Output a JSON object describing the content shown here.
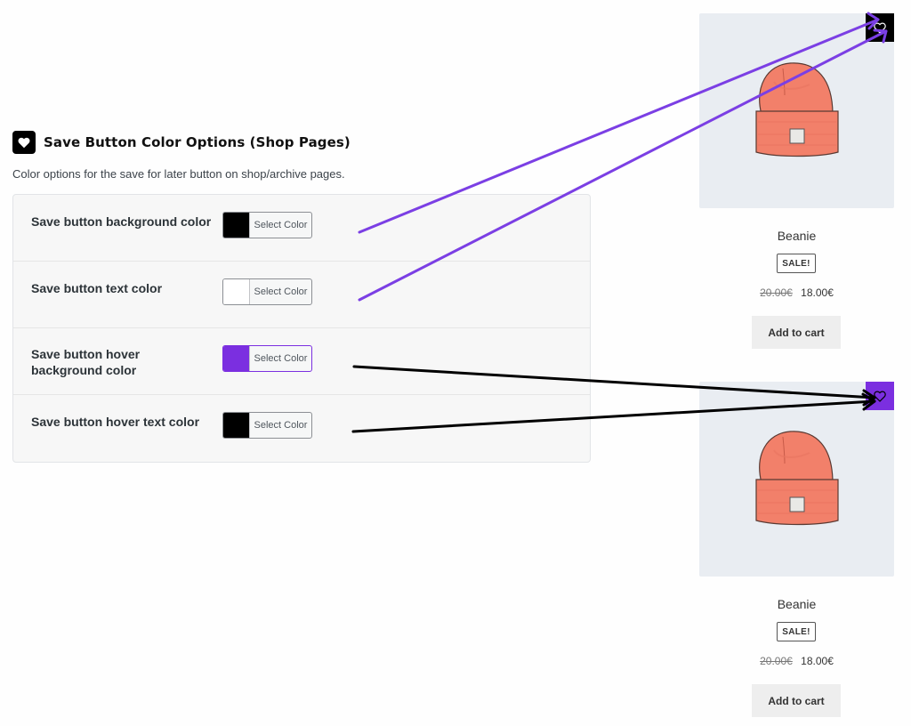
{
  "settings": {
    "title": "Save Button Color Options (Shop Pages)",
    "description": "Color options for the save for later button on shop/archive pages.",
    "rows": [
      {
        "label": "Save button background color",
        "button": "Select Color",
        "color": "#000000"
      },
      {
        "label": "Save button text color",
        "button": "Select Color",
        "color": "#ffffff"
      },
      {
        "label": "Save button hover background color",
        "button": "Select Color",
        "color": "#7b2fe0"
      },
      {
        "label": "Save button hover text color",
        "button": "Select Color",
        "color": "#000000"
      }
    ]
  },
  "products": [
    {
      "name": "Beanie",
      "badge": "SALE!",
      "old_price": "20.00€",
      "new_price": "18.00€",
      "cart_label": "Add to cart",
      "save_button_bg": "#000000",
      "save_icon": "heart-outline-icon"
    },
    {
      "name": "Beanie",
      "badge": "SALE!",
      "old_price": "20.00€",
      "new_price": "18.00€",
      "cart_label": "Add to cart",
      "save_button_bg": "#7b2fe0",
      "save_icon": "heart-outline-icon"
    }
  ],
  "colors": {
    "annotation_purple": "#7b3fe4",
    "annotation_black": "#000000",
    "product_image_bg": "#e9edf2"
  }
}
